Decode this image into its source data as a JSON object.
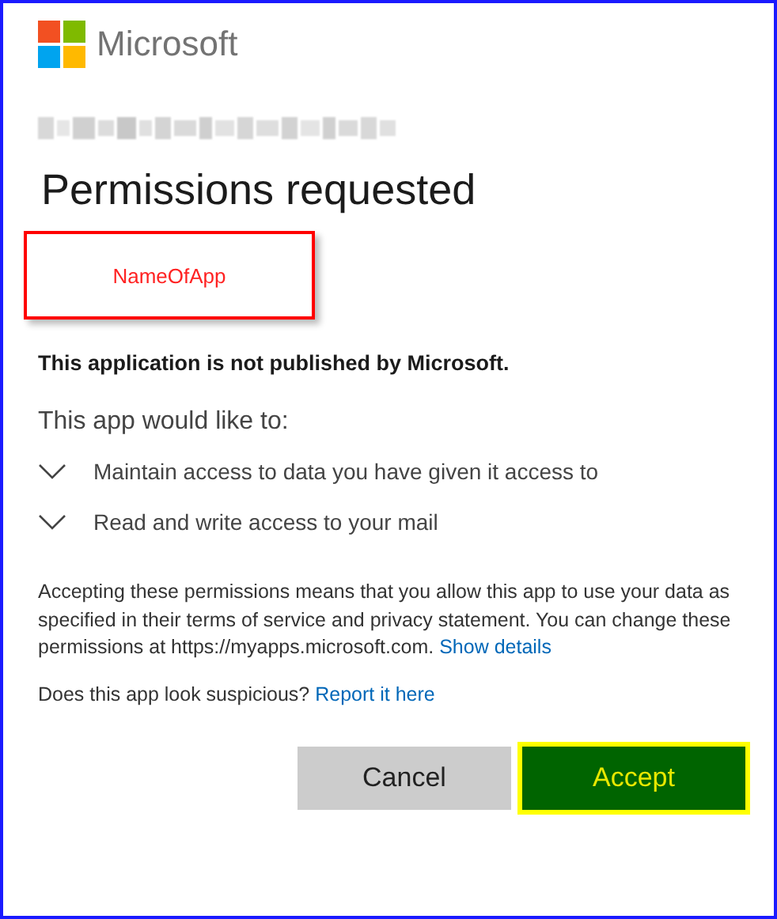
{
  "brand": {
    "name": "Microsoft"
  },
  "title": "Permissions requested",
  "app_name": "NameOfApp",
  "publisher_notice": "This application is not published by Microsoft.",
  "intro": "This app would like to:",
  "permissions": [
    {
      "label": "Maintain access to data you have given it access to"
    },
    {
      "label": "Read and write access to your mail"
    }
  ],
  "consent": {
    "text": "Accepting these permissions means that you allow this app to use your data as specified in their terms of service and privacy statement. You can change these permissions at https://myapps.microsoft.com.",
    "link": "Show details"
  },
  "suspicious": {
    "text": "Does this app look suspicious?",
    "link": "Report it here"
  },
  "buttons": [
    {
      "label": "Cancel",
      "kind": "secondary"
    },
    {
      "label": "Accept",
      "kind": "primary"
    }
  ]
}
